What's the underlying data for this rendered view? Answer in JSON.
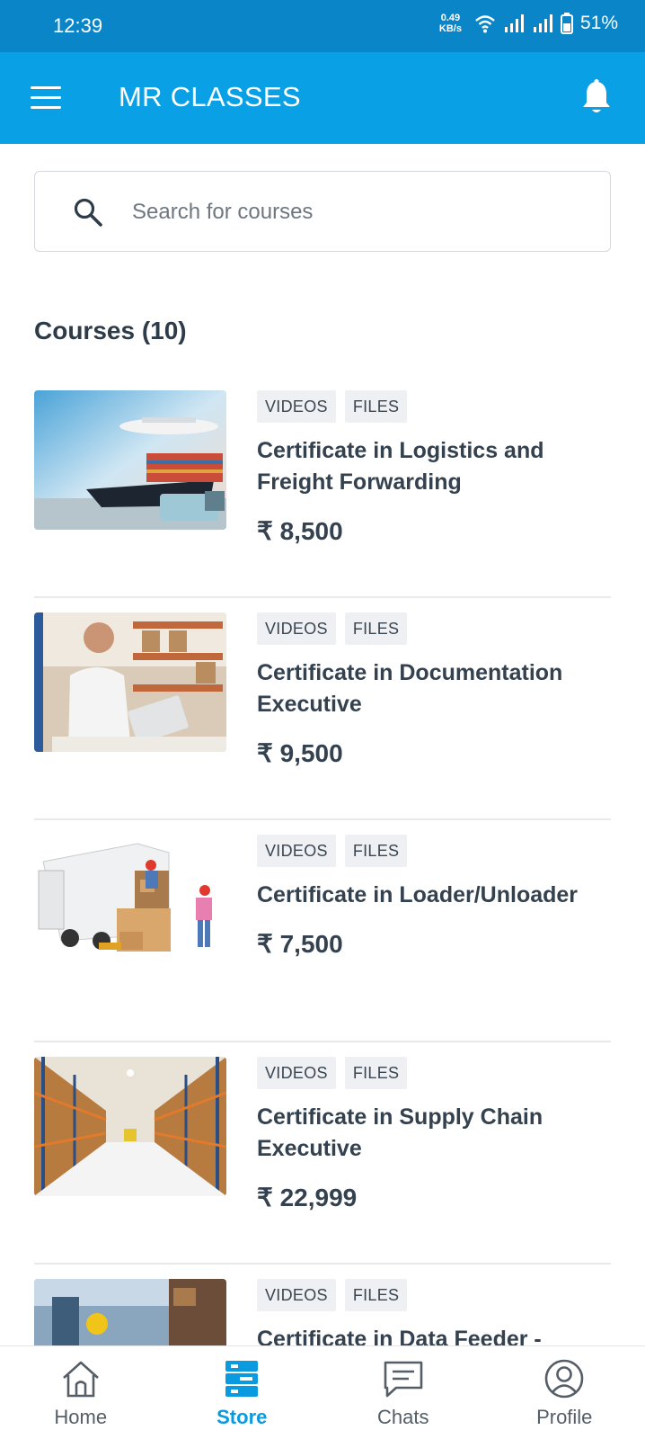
{
  "status_bar": {
    "time": "12:39",
    "net_speed_value": "0.49",
    "net_speed_unit": "KB/s",
    "battery": "51%"
  },
  "app_bar": {
    "title": "MR CLASSES",
    "menu_icon": "hamburger-menu-icon",
    "notification_icon": "bell-icon"
  },
  "search": {
    "placeholder": "Search for courses",
    "value": ""
  },
  "section_title": "Courses (10)",
  "courses": [
    {
      "tags": [
        "VIDEOS",
        "FILES"
      ],
      "title": "Certificate in Logistics and Freight Forwarding",
      "price": "₹ 8,500",
      "image": "logistics-transport-image"
    },
    {
      "tags": [
        "VIDEOS",
        "FILES"
      ],
      "title": "Certificate in Documentation Executive",
      "price": "₹ 9,500",
      "image": "warehouse-documentation-image"
    },
    {
      "tags": [
        "VIDEOS",
        "FILES"
      ],
      "title": "Certificate in Loader/Unloader",
      "price": "₹ 7,500",
      "image": "truck-loading-image"
    },
    {
      "tags": [
        "VIDEOS",
        "FILES"
      ],
      "title": "Certificate in Supply Chain Executive",
      "price": "₹ 22,999",
      "image": "warehouse-aisle-image"
    },
    {
      "tags": [
        "VIDEOS",
        "FILES"
      ],
      "title": "Certificate in Data Feeder -",
      "price": "",
      "image": "warehouse-worker-image"
    }
  ],
  "bottom_nav": [
    {
      "label": "Home",
      "icon": "home-icon",
      "active": false
    },
    {
      "label": "Store",
      "icon": "store-icon",
      "active": true
    },
    {
      "label": "Chats",
      "icon": "chat-icon",
      "active": false
    },
    {
      "label": "Profile",
      "icon": "profile-icon",
      "active": false
    }
  ],
  "colors": {
    "status_bar": "#0a86c8",
    "app_bar": "#0aa0e6",
    "accent": "#0a9ae0",
    "text_dark": "#34414e",
    "tag_bg": "#eef0f3"
  }
}
